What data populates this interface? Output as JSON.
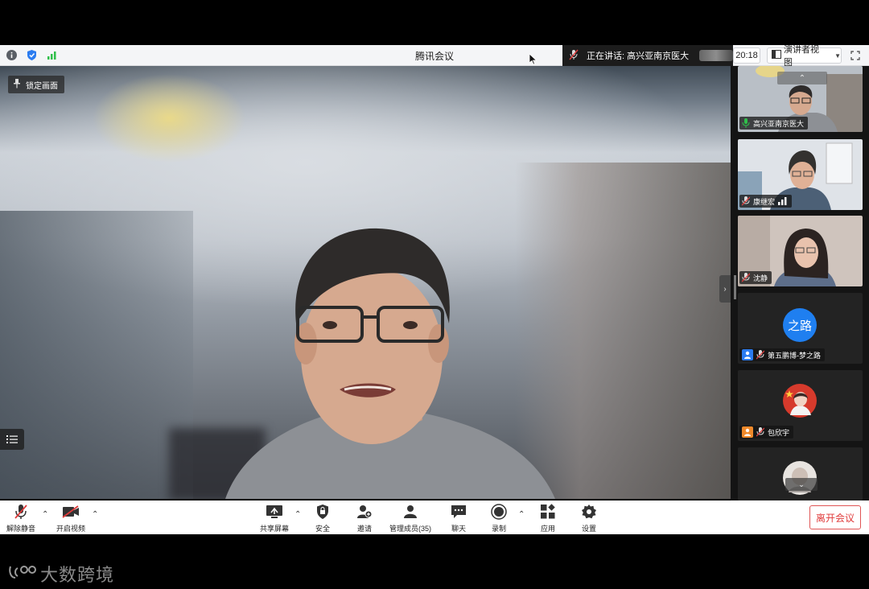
{
  "window": {
    "title": "腾讯会议"
  },
  "speaking": {
    "label": "正在讲话: 高兴亚南京医大"
  },
  "header": {
    "time": "20:18",
    "view_label": "演讲者视图"
  },
  "main": {
    "lock_label": "锁定画面"
  },
  "participants": [
    {
      "name": "高兴亚南京医大"
    },
    {
      "name": "康继宏"
    },
    {
      "name": "沈静"
    },
    {
      "name": "第五鹏博-梦之路",
      "avatar_text": "之路"
    },
    {
      "name": "包欣宇"
    }
  ],
  "toolbar": {
    "unmute": "解除静音",
    "start_video": "开启视频",
    "share_screen": "共享屏幕",
    "security": "安全",
    "invite": "邀请",
    "manage_members": "管理成员(35)",
    "chat": "聊天",
    "record": "录制",
    "apps": "应用",
    "settings": "设置",
    "leave": "离开会议"
  },
  "watermark": {
    "text": "大数跨境",
    "logo": "tcc"
  },
  "colors": {
    "accent": "#1f7ff0",
    "leave": "#e03a3a",
    "mic_active": "#2fbf4a"
  }
}
